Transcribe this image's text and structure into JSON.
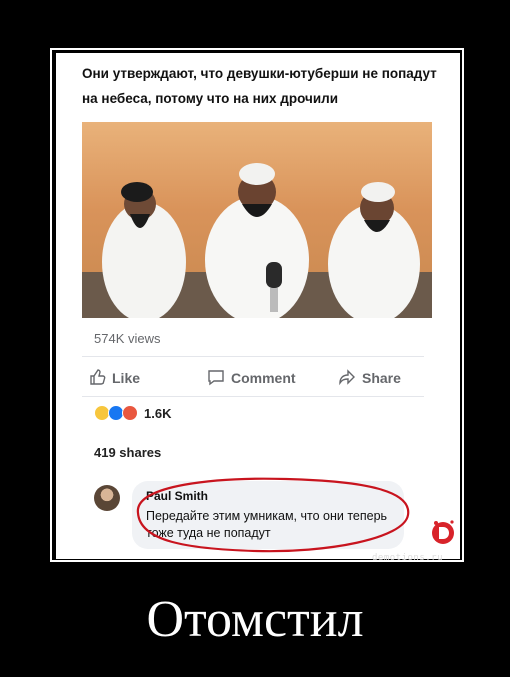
{
  "post": {
    "headline": "Они утверждают, что девушки-ютуберши не попадут на небеса, потому что на них дрочили",
    "views": "574K views",
    "actions": {
      "like": "Like",
      "comment": "Comment",
      "share": "Share"
    },
    "reactions": {
      "icons": [
        "haha",
        "like",
        "angry"
      ],
      "count": "1.6K"
    },
    "shares": "419 shares",
    "comment": {
      "author": "Paul Smith",
      "text": "Передайте этим умникам, что они теперь тоже туда не попадут"
    }
  },
  "watermark": "demotions.ru",
  "caption": "Отомстил",
  "colors": {
    "background": "#000000",
    "accent_red": "#c8141e",
    "text_muted": "#65676b"
  }
}
